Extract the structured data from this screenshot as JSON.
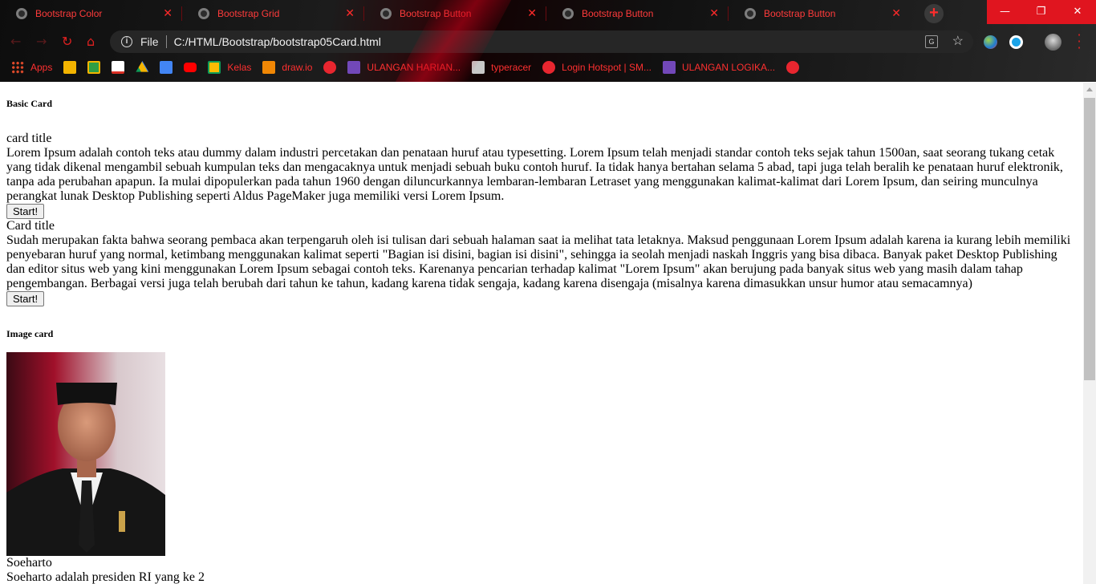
{
  "browser": {
    "tabs": [
      {
        "title": "Bootstrap Color"
      },
      {
        "title": "Bootstrap Grid"
      },
      {
        "title": "Bootstrap Button"
      },
      {
        "title": "Bootstrap Button"
      },
      {
        "title": "Bootstrap Button"
      }
    ],
    "address": {
      "scheme": "File",
      "url": "C:/HTML/Bootstrap/bootstrap05Card.html"
    },
    "bookmarks": [
      {
        "label": "Apps",
        "icon": "apps-grid-icon"
      },
      {
        "label": "",
        "icon": "slides-icon"
      },
      {
        "label": "",
        "icon": "classroom-icon"
      },
      {
        "label": "",
        "icon": "gmail-icon"
      },
      {
        "label": "",
        "icon": "drive-icon"
      },
      {
        "label": "",
        "icon": "docs-icon"
      },
      {
        "label": "",
        "icon": "youtube-icon"
      },
      {
        "label": "Kelas",
        "icon": "classroom-icon"
      },
      {
        "label": "draw.io",
        "icon": "drawio-icon"
      },
      {
        "label": "",
        "icon": "globe-red-icon"
      },
      {
        "label": "ULANGAN HARIAN...",
        "icon": "forms-icon"
      },
      {
        "label": "typeracer",
        "icon": "typeracer-icon"
      },
      {
        "label": "Login Hotspot | SM...",
        "icon": "globe-red-icon"
      },
      {
        "label": "ULANGAN LOGIKA...",
        "icon": "forms-icon"
      },
      {
        "label": "",
        "icon": "globe-red-icon"
      }
    ],
    "accent_color": "#ff3030"
  },
  "page": {
    "basic_heading": "Basic Card",
    "cards": [
      {
        "title": "card title",
        "text": "Lorem Ipsum adalah contoh teks atau dummy dalam industri percetakan dan penataan huruf atau typesetting. Lorem Ipsum telah menjadi standar contoh teks sejak tahun 1500an, saat seorang tukang cetak yang tidak dikenal mengambil sebuah kumpulan teks dan mengacaknya untuk menjadi sebuah buku contoh huruf. Ia tidak hanya bertahan selama 5 abad, tapi juga telah beralih ke penataan huruf elektronik, tanpa ada perubahan apapun. Ia mulai dipopulerkan pada tahun 1960 dengan diluncurkannya lembaran-lembaran Letraset yang menggunakan kalimat-kalimat dari Lorem Ipsum, dan seiring munculnya perangkat lunak Desktop Publishing seperti Aldus PageMaker juga memiliki versi Lorem Ipsum.",
        "button": "Start!"
      },
      {
        "title": "Card title",
        "text": "Sudah merupakan fakta bahwa seorang pembaca akan terpengaruh oleh isi tulisan dari sebuah halaman saat ia melihat tata letaknya. Maksud penggunaan Lorem Ipsum adalah karena ia kurang lebih memiliki penyebaran huruf yang normal, ketimbang menggunakan kalimat seperti \"Bagian isi disini, bagian isi disini\", sehingga ia seolah menjadi naskah Inggris yang bisa dibaca. Banyak paket Desktop Publishing dan editor situs web yang kini menggunakan Lorem Ipsum sebagai contoh teks. Karenanya pencarian terhadap kalimat \"Lorem Ipsum\" akan berujung pada banyak situs web yang masih dalam tahap pengembangan. Berbagai versi juga telah berubah dari tahun ke tahun, kadang karena tidak sengaja, kadang karena disengaja (misalnya karena dimasukkan unsur humor atau semacamnya)",
        "button": "Start!"
      }
    ],
    "image_heading": "Image card",
    "image_card": {
      "title": "Soeharto",
      "text": "Soeharto adalah presiden RI yang ke 2"
    }
  }
}
